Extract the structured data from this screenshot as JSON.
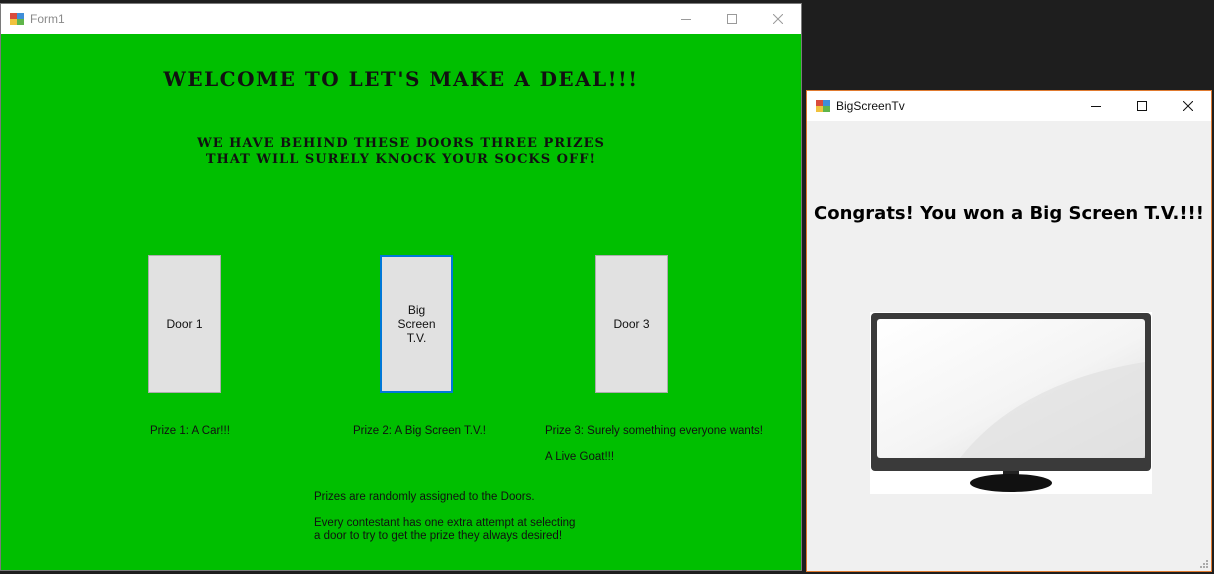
{
  "form1": {
    "title": "Form1",
    "heading": "Welcome to Let's Make a Deal!!!",
    "subtitle_line1": "We have behind these doors three prizes",
    "subtitle_line2": "that will surely knock your socks off!",
    "doors": [
      {
        "label": "Door 1"
      },
      {
        "label": "Big Screen T.V."
      },
      {
        "label": "Door 3"
      }
    ],
    "prizes": [
      "Prize 1: A Car!!!",
      "Prize 2: A Big Screen T.V.!",
      "Prize 3: Surely something everyone wants!"
    ],
    "prize3_detail": "A Live Goat!!!",
    "note_random": "Prizes are randomly assigned to the Doors.",
    "note_attempt_line1": "Every contestant has one extra attempt at selecting",
    "note_attempt_line2": "a door to try to get the prize they always desired!",
    "background_color": "#00bf00"
  },
  "bigtv": {
    "title": "BigScreenTv",
    "message": "Congrats! You won a Big Screen T.V.!!!",
    "image_icon": "tv-icon"
  },
  "window_controls": [
    "minimize-icon",
    "maximize-icon",
    "close-icon"
  ]
}
